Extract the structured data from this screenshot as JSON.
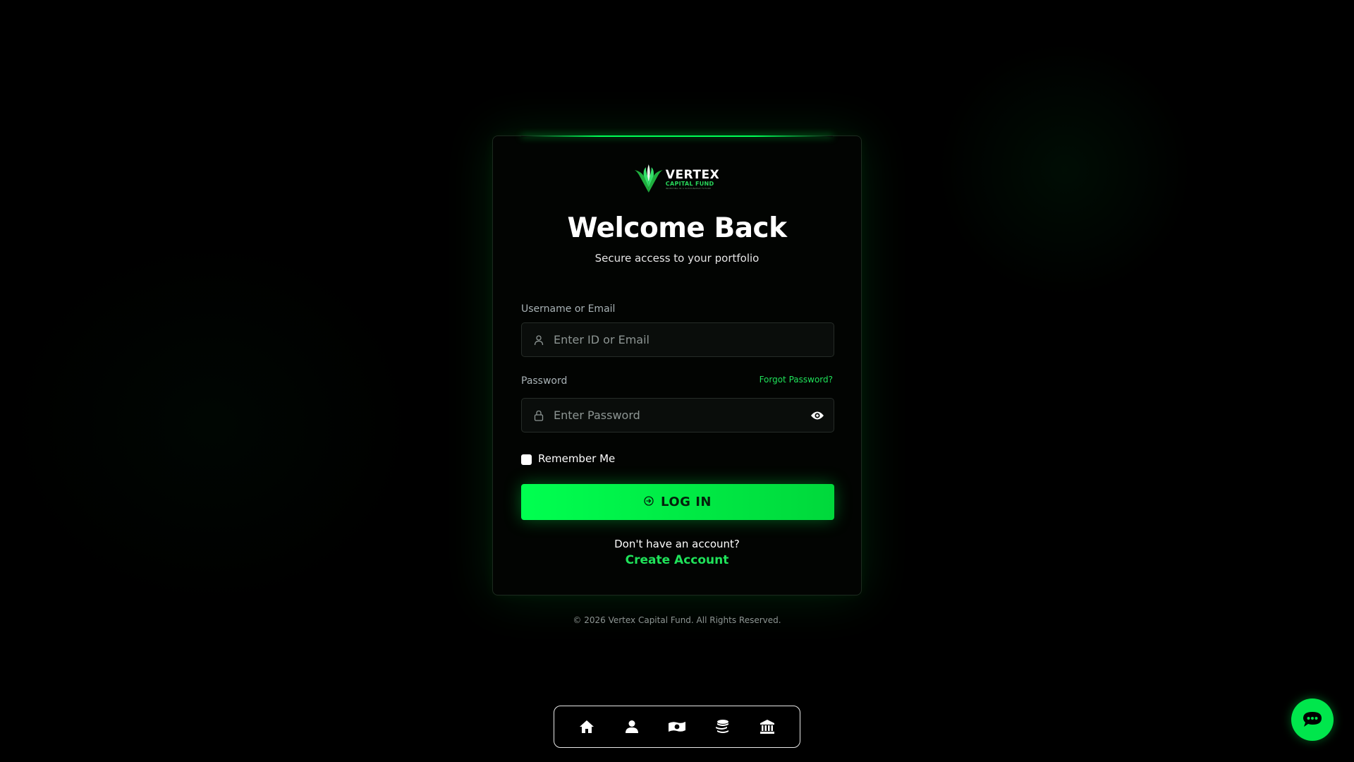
{
  "brand": {
    "name": "VERTEX",
    "subname": "CAPITAL FUND",
    "tagline": "INVESTING IN A SUSTAINABLE FUTURE"
  },
  "login": {
    "title": "Welcome Back",
    "subtitle": "Secure access to your portfolio",
    "username_label": "Username or Email",
    "username_placeholder": "Enter ID or Email",
    "password_label": "Password",
    "password_placeholder": "Enter Password",
    "forgot_label": "Forgot Password?",
    "remember_label": "Remember Me",
    "remember_checked": false,
    "login_button": "LOG IN",
    "no_account": "Don't have an account?",
    "create_account": "Create Account"
  },
  "footer": {
    "copyright": "© 2026 Vertex Capital Fund. All Rights Reserved."
  },
  "dock": {
    "items": [
      {
        "icon": "home-icon"
      },
      {
        "icon": "user-icon"
      },
      {
        "icon": "money-icon"
      },
      {
        "icon": "coins-icon"
      },
      {
        "icon": "bank-icon"
      }
    ]
  },
  "chat": {
    "icon": "chat-icon"
  },
  "colors": {
    "accent": "#00ff50",
    "link": "#1fe35a",
    "background": "#000000",
    "card": "#020402"
  }
}
